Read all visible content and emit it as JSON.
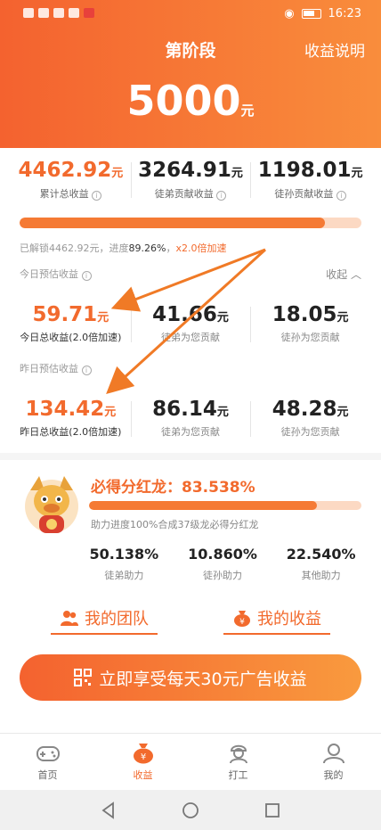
{
  "status_bar": {
    "time": "16:23"
  },
  "header": {
    "title": "第阶段",
    "help_link": "收益说明",
    "target_amount": "5000",
    "target_unit": "元"
  },
  "totals": [
    {
      "value": "4462.92",
      "unit": "元",
      "label": "累计总收益"
    },
    {
      "value": "3264.91",
      "unit": "元",
      "label": "徒弟贡献收益"
    },
    {
      "value": "1198.01",
      "unit": "元",
      "label": "徒孙贡献收益"
    }
  ],
  "unlock": {
    "progress_fraction": 0.8926,
    "prefix": "已解锁4462.92元，进度",
    "percent": "89.26%",
    "separator": "，",
    "speed": "x2.0倍加速"
  },
  "today": {
    "label": "今日预估收益",
    "collapse_label": "收起",
    "cells": [
      {
        "value": "59.71",
        "unit": "元",
        "label": "今日总收益(2.0倍加速)"
      },
      {
        "value": "41.66",
        "unit": "元",
        "label": "徒弟为您贡献"
      },
      {
        "value": "18.05",
        "unit": "元",
        "label": "徒孙为您贡献"
      }
    ]
  },
  "yesterday": {
    "label": "昨日预估收益",
    "cells": [
      {
        "value": "134.42",
        "unit": "元",
        "label": "昨日总收益(2.0倍加速)"
      },
      {
        "value": "86.14",
        "unit": "元",
        "label": "徒弟为您贡献"
      },
      {
        "value": "48.28",
        "unit": "元",
        "label": "徒孙为您贡献"
      }
    ]
  },
  "dragon": {
    "title": "必得分红龙：83.538%",
    "progress_fraction": 0.83538,
    "desc": "助力进度100%合成37级龙必得分红龙",
    "help": [
      {
        "value": "50.138%",
        "label": "徒弟助力"
      },
      {
        "value": "10.860%",
        "label": "徒孙助力"
      },
      {
        "value": "22.540%",
        "label": "其他助力"
      }
    ]
  },
  "links": {
    "team": "我的团队",
    "income": "我的收益"
  },
  "cta": {
    "label": "立即享受每天30元广告收益"
  },
  "tabs": [
    {
      "label": "首页",
      "icon": "gamepad-icon"
    },
    {
      "label": "收益",
      "icon": "money-bag-icon"
    },
    {
      "label": "打工",
      "icon": "worker-icon"
    },
    {
      "label": "我的",
      "icon": "user-icon"
    }
  ],
  "colors": {
    "accent": "#f26a2d",
    "bar_track": "#fcd9c3"
  }
}
